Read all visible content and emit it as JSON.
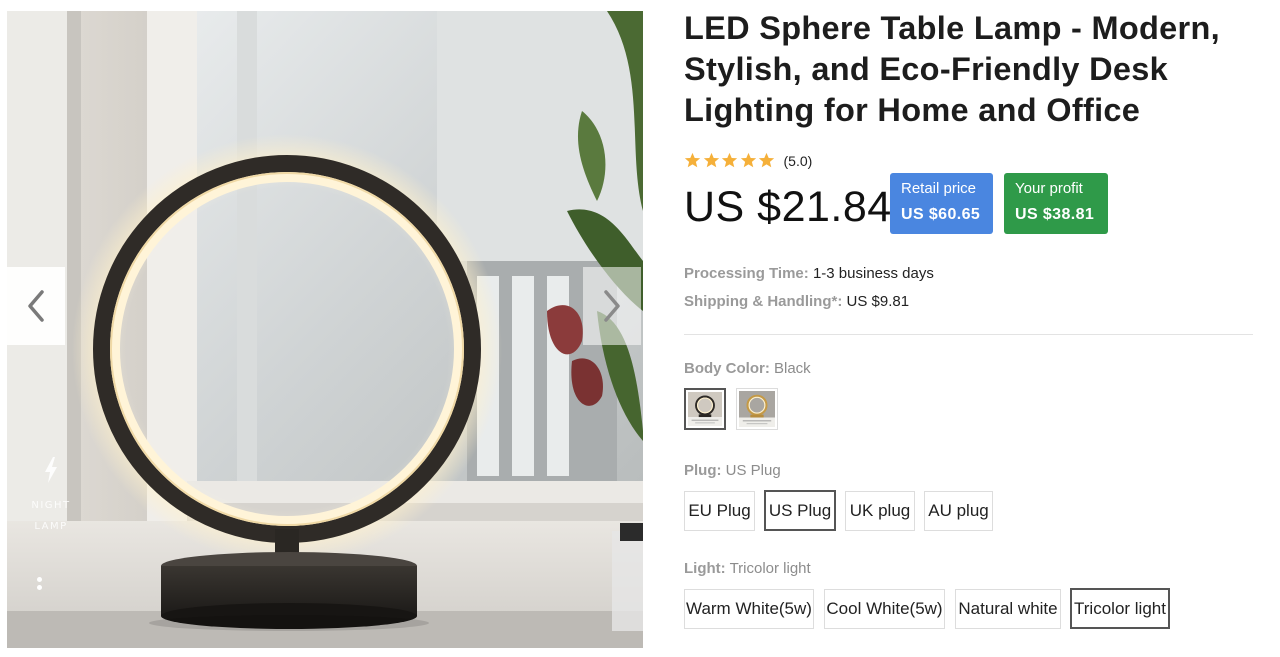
{
  "gallery": {
    "badge_lines": [
      "NIGHT",
      "LAMP"
    ]
  },
  "product": {
    "title": "LED Sphere Table Lamp - Modern, Stylish, and Eco-Friendly Desk Lighting for Home and Office",
    "rating": {
      "stars": 5,
      "text": "(5.0)"
    },
    "price": "US $21.84",
    "retail": {
      "label": "Retail price",
      "value": "US $60.65"
    },
    "profit": {
      "label": "Your profit",
      "value": "US $38.81"
    },
    "processing": {
      "label": "Processing Time:",
      "value": "1-3 business days"
    },
    "shipping": {
      "label": "Shipping & Handling*:",
      "value": "US $9.81"
    }
  },
  "options": {
    "body_color": {
      "label": "Body Color:",
      "selected": "Black",
      "swatches": [
        "Black",
        "Gold"
      ]
    },
    "plug": {
      "label": "Plug:",
      "selected": "US Plug",
      "choices": [
        "EU Plug",
        "US Plug",
        "UK plug",
        "AU plug"
      ]
    },
    "light": {
      "label": "Light:",
      "selected": "Tricolor light",
      "choices": [
        "Warm White(5w)",
        "Cool White(5w)",
        "Natural white",
        "Tricolor light"
      ]
    }
  },
  "colors": {
    "retail_bg": "#4a86e0",
    "profit_bg": "#2f9a49",
    "star": "#f5b03a"
  },
  "icons": {
    "prev": "chevron-left-icon",
    "next": "chevron-right-icon",
    "badge": "lightning-icon"
  }
}
